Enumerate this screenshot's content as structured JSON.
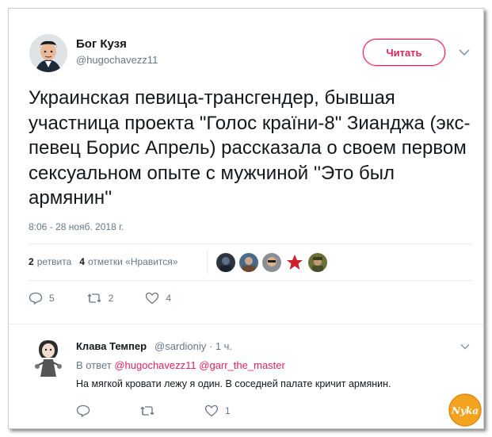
{
  "tweet": {
    "author_name": "Бог Кузя",
    "author_handle": "@hugochavezz11",
    "follow_label": "Читать",
    "text": "Украинская певица-трансгендер, бывшая участница проекта \"Голос країни-8\" Зианджа (экс-певец Борис Апрель) рассказала о своем первом сексуальном опыте с мужчиной ''Это был армянин''",
    "timestamp": "8:06 - 28 нояб. 2018 г.",
    "retweets_count": "2",
    "retweets_label": "ретвита",
    "likes_count": "4",
    "likes_label": "отметки «Нравится»",
    "reply_count": "5",
    "retweet_action_count": "2",
    "like_action_count": "4"
  },
  "reply": {
    "author_name": "Клава Темпер",
    "author_handle": "@sardioniy",
    "age": "1 ч.",
    "in_reply_prefix": "В ответ",
    "mention_1": "@hugochavezz11",
    "mention_2": "@garr_the_master",
    "text": "На мягкой кровати лежу я один. В соседней палате кричит армянин.",
    "retweet_count": "",
    "like_count": "1"
  },
  "icons": {
    "caret": "chevron-down-icon",
    "reply": "reply-icon",
    "retweet": "retweet-icon",
    "like": "heart-icon"
  },
  "watermark": {
    "text": "Nyka"
  },
  "colors": {
    "accent": "#e0245e",
    "secondary_text": "#657786",
    "primary_text": "#14171a",
    "divider": "#e6ecf0"
  }
}
